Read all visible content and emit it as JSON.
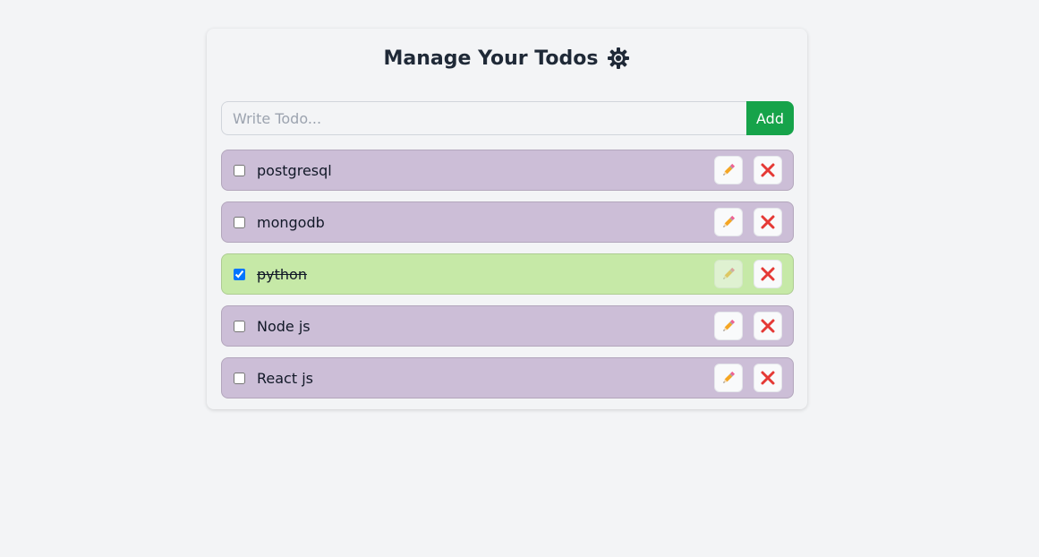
{
  "header": {
    "title": "Manage Your Todos",
    "theme_icon": "gear-icon"
  },
  "form": {
    "placeholder": "Write Todo...",
    "value": "",
    "add_label": "Add"
  },
  "colors": {
    "pending_bg": "#ccbed7",
    "done_bg": "#c6e9a7",
    "add_button": "#16a34a",
    "delete_icon": "#e53935"
  },
  "todos": [
    {
      "text": "postgresql",
      "completed": false,
      "edit_icon": "pencil-icon",
      "delete_icon": "close-icon"
    },
    {
      "text": "mongodb",
      "completed": false,
      "edit_icon": "pencil-icon",
      "delete_icon": "close-icon"
    },
    {
      "text": "python",
      "completed": true,
      "edit_icon": "pencil-icon",
      "delete_icon": "close-icon"
    },
    {
      "text": "Node js",
      "completed": false,
      "edit_icon": "pencil-icon",
      "delete_icon": "close-icon"
    },
    {
      "text": "React js",
      "completed": false,
      "edit_icon": "pencil-icon",
      "delete_icon": "close-icon"
    }
  ]
}
